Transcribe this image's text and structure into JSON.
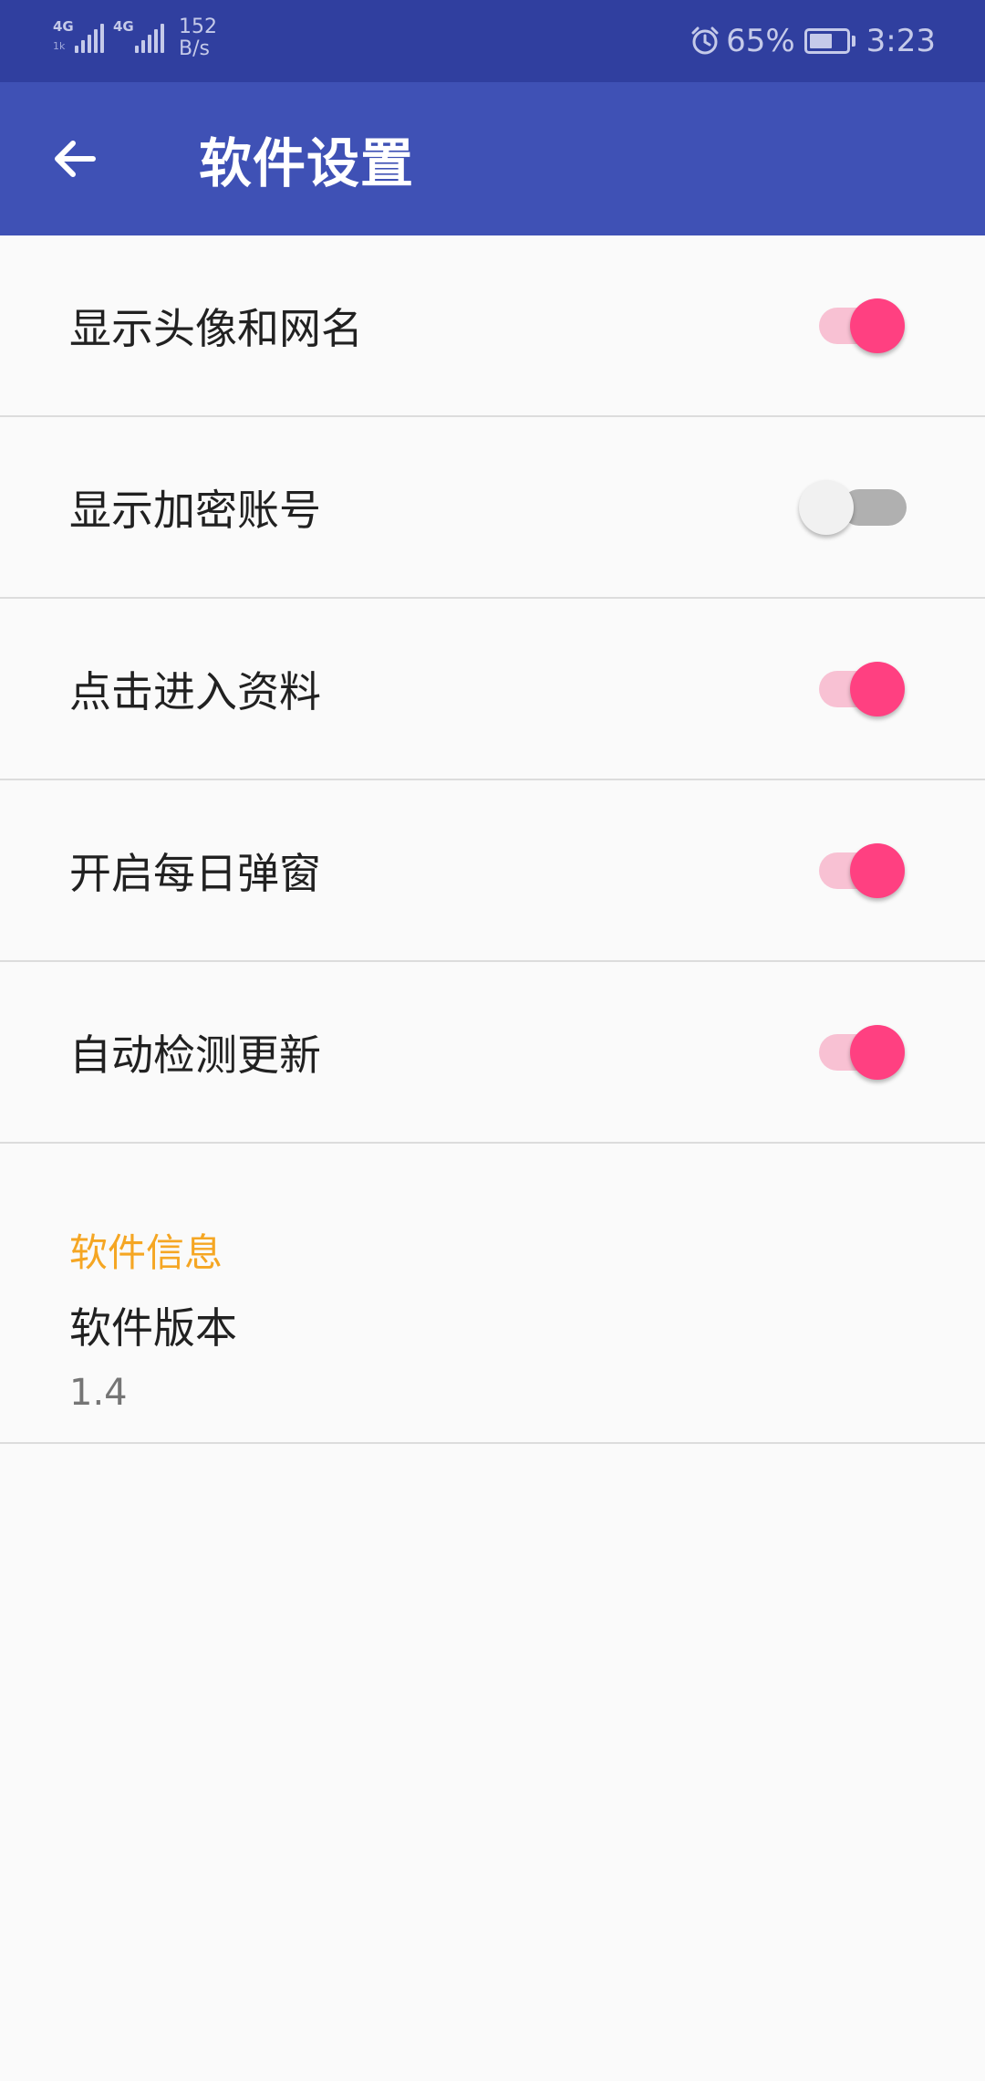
{
  "status_bar": {
    "signal_1": {
      "network": "4G",
      "sub": "1k"
    },
    "signal_2": {
      "network": "4G"
    },
    "speed_value": "152",
    "speed_unit": "B/s",
    "alarm_icon": "alarm-clock-icon",
    "battery_percent": "65%",
    "battery_level": 0.65,
    "time": "3:23"
  },
  "app_bar": {
    "back_icon": "arrow-left-icon",
    "title": "软件设置",
    "background_color": "#3f51b5",
    "status_color": "#303f9f"
  },
  "settings": [
    {
      "label": "显示头像和网名",
      "enabled": true
    },
    {
      "label": "显示加密账号",
      "enabled": false
    },
    {
      "label": "点击进入资料",
      "enabled": true
    },
    {
      "label": "开启每日弹窗",
      "enabled": true
    },
    {
      "label": "自动检测更新",
      "enabled": true
    }
  ],
  "accent_color": "#ff4081",
  "info": {
    "section_header": "软件信息",
    "header_color": "#f5a623",
    "version_title": "软件版本",
    "version_value": "1.4"
  }
}
